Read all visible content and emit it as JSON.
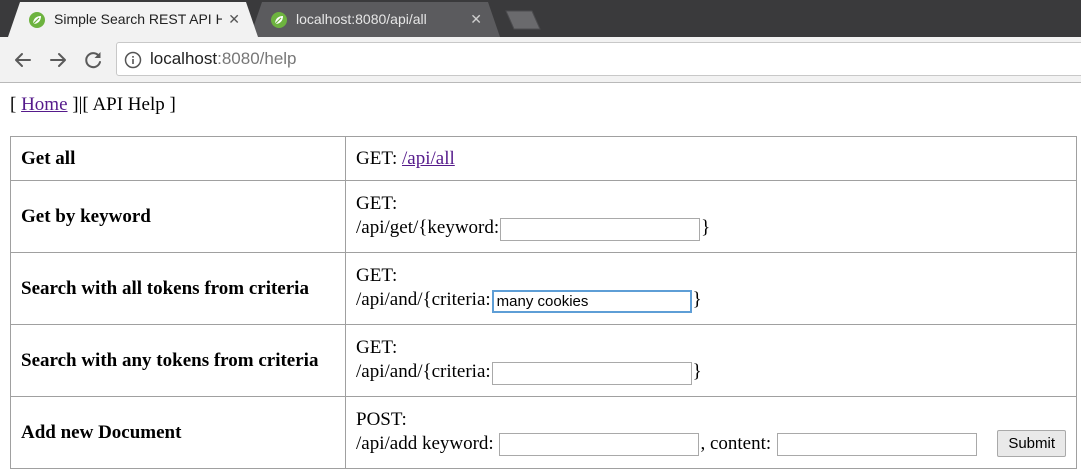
{
  "browser": {
    "tabs": [
      {
        "title": "Simple Search REST API H",
        "active": true,
        "icon": "spring-leaf-icon"
      },
      {
        "title": "localhost:8080/api/all",
        "active": false,
        "icon": "spring-leaf-icon"
      }
    ],
    "close_glyph": "✕",
    "address": {
      "host": "localhost",
      "rest": ":8080/help"
    },
    "colors": {
      "tabstrip": "#3a3a3c",
      "active_tab": "#f2f2f2",
      "favicon": "#6db33f"
    }
  },
  "nav": {
    "open_bracket": "[ ",
    "home": "Home",
    "middle": " ]|[ ",
    "current": "API Help",
    "close_bracket": " ]"
  },
  "endpoints": [
    {
      "label": "Get all",
      "method": "GET:",
      "link": "/api/all"
    },
    {
      "label": "Get by keyword",
      "method": "GET:",
      "prefix": "/api/get/{keyword:",
      "suffix": "}",
      "value": ""
    },
    {
      "label": "Search with all tokens from criteria",
      "method": "GET:",
      "prefix": "/api/and/{criteria:",
      "suffix": "}",
      "value": "many cookies"
    },
    {
      "label": "Search with any tokens from criteria",
      "method": "GET:",
      "prefix": "/api/and/{criteria:",
      "suffix": "}",
      "value": ""
    },
    {
      "label": "Add new Document",
      "method": "POST:",
      "prefix": "/api/add keyword:",
      "middle": ", content:",
      "keyword_value": "",
      "content_value": "",
      "button": "Submit"
    }
  ]
}
